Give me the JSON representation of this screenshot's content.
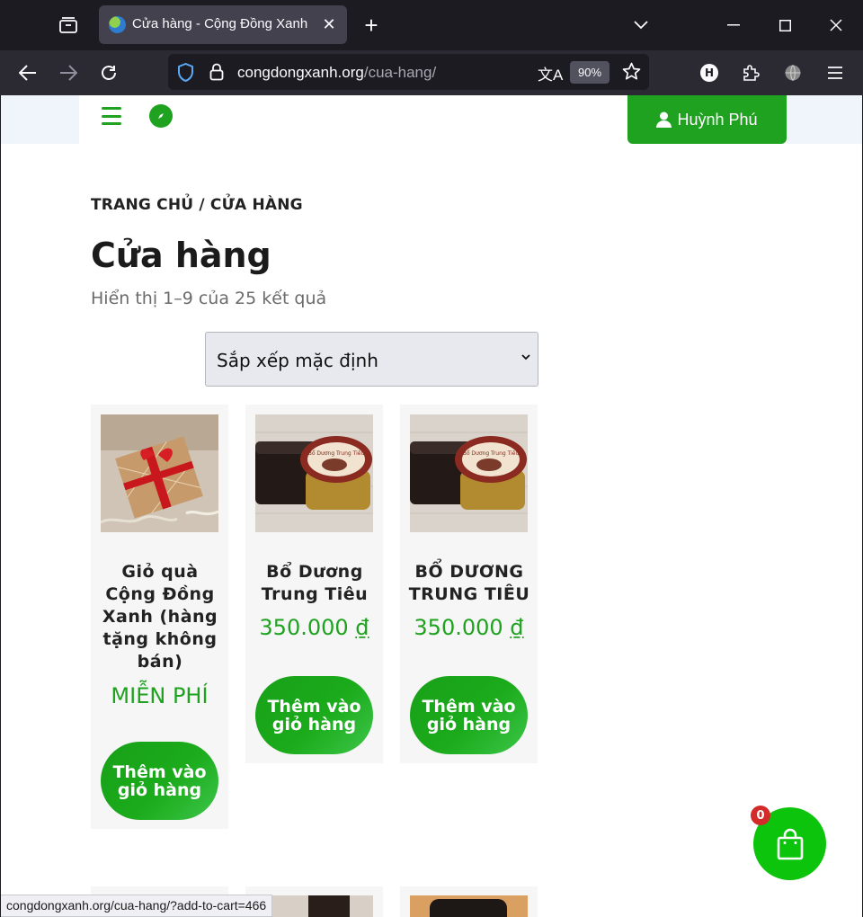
{
  "browser": {
    "tab_title": "Cửa hàng - Cộng Đồng Xanh",
    "url_host": "congdongxanh.org",
    "url_path": "/cua-hang/",
    "zoom": "90%",
    "profile_initial": "H"
  },
  "header": {
    "account_label": "Huỳnh Phú"
  },
  "breadcrumb": "TRANG CHỦ / CỬA HÀNG",
  "page_title": "Cửa hàng",
  "result_count": "Hiển thị 1–9 của 25 kết quả",
  "sort": {
    "selected": "Sắp xếp mặc định"
  },
  "products": [
    {
      "name": "Giỏ quà Cộng Đồng Xanh (hàng tặng không bán)",
      "price": "MIỄN PHÍ",
      "currency": "",
      "button": "Thêm vào giỏ hàng"
    },
    {
      "name": "Bổ Dương Trung Tiêu",
      "price": "350.000",
      "currency": "₫",
      "button": "Thêm vào giỏ hàng"
    },
    {
      "name": "BỔ DƯƠNG TRUNG TIÊU",
      "price": "350.000",
      "currency": "₫",
      "button": "Thêm vào giỏ hàng"
    }
  ],
  "jar_label": "Bổ Dương Trung Tiêu",
  "cart": {
    "count": "0"
  },
  "status_url": "congdongxanh.org/cua-hang/?add-to-cart=466",
  "colors": {
    "accent": "#1fa21f",
    "fab": "#0cc40c",
    "badge": "#d32a2a"
  }
}
